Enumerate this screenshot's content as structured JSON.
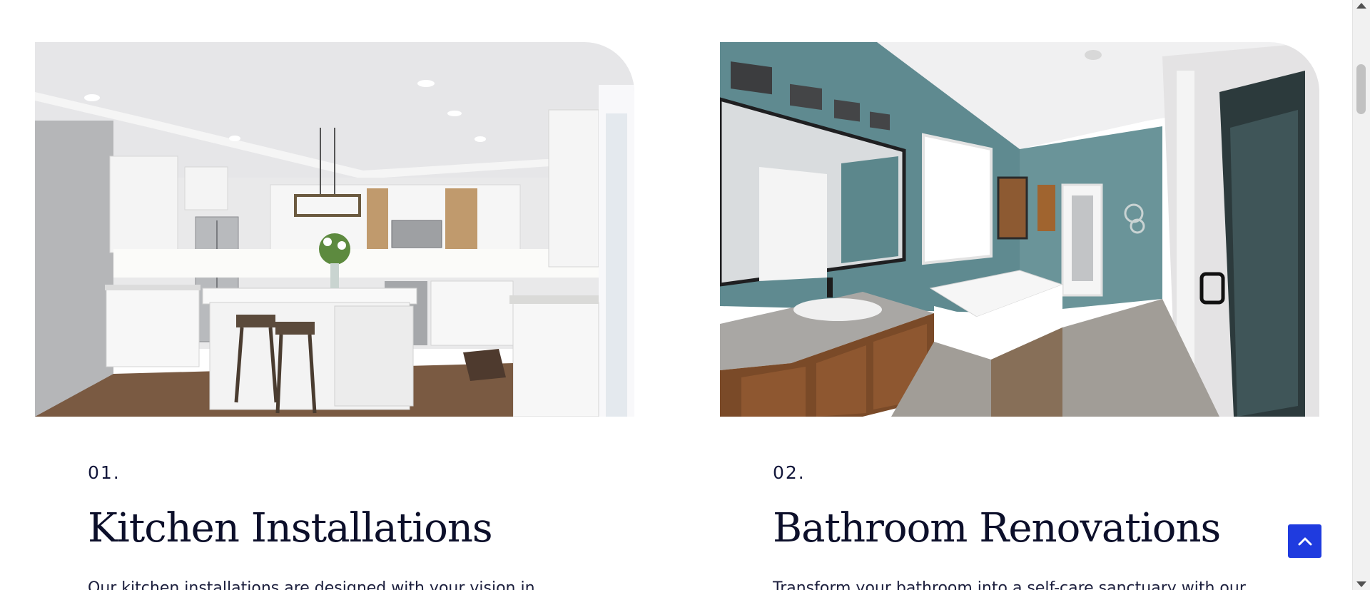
{
  "services": [
    {
      "number": "01.",
      "title": "Kitchen Installations",
      "description": "Our kitchen installations are designed with your vision in",
      "image": "kitchen-photo"
    },
    {
      "number": "02.",
      "title": "Bathroom Renovations",
      "description": "Transform your bathroom into a self-care sanctuary with our",
      "image": "bathroom-photo"
    }
  ],
  "back_to_top": {
    "icon": "chevron-up-icon"
  },
  "colors": {
    "accent": "#1f3bdf",
    "heading": "#0c0f2a",
    "body_text": "#1c1f3d",
    "background": "#ffffff"
  }
}
